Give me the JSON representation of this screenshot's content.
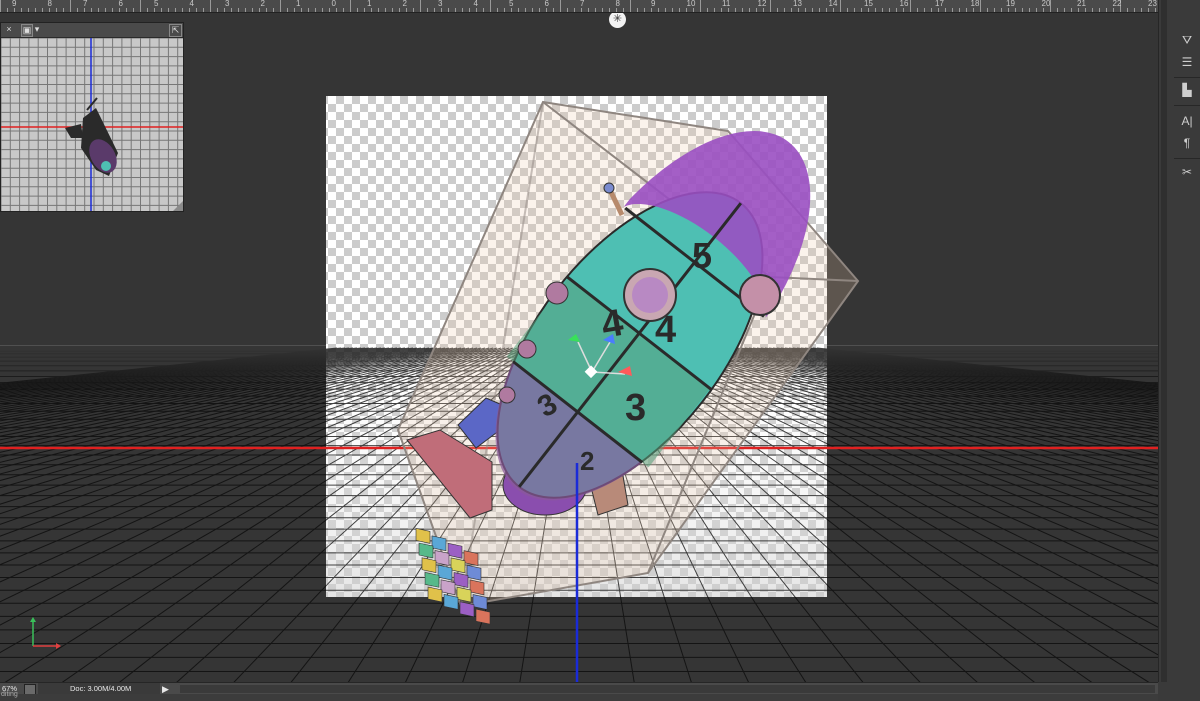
{
  "ruler": {
    "numbers": [
      "9",
      "8",
      "7",
      "6",
      "5",
      "4",
      "3",
      "2",
      "1",
      "0",
      "1",
      "2",
      "3",
      "4",
      "5",
      "6",
      "7",
      "8",
      "9",
      "10",
      "11",
      "12",
      "13",
      "14",
      "15",
      "16",
      "17",
      "18",
      "19",
      "20",
      "21",
      "22",
      "23"
    ]
  },
  "mini_view": {
    "close_label": "×",
    "menu_label": "▾"
  },
  "canvas": {
    "numbers": [
      "5",
      "4",
      "4",
      "3",
      "3",
      "2"
    ]
  },
  "status_bar": {
    "zoom": "67%",
    "doc_info": "Doc: 3.00M/4.00M",
    "bottom_text": "diting"
  },
  "colors": {
    "background": "#363636",
    "ruler": "#4a4a4a",
    "ground_line": "#e02020",
    "axis_line": "#1a2bd8",
    "panel": "#3a3a3a"
  },
  "icons": {
    "tools": [
      "brush-preset-icon",
      "adjustments-icon",
      "align-icon",
      "character-icon",
      "paragraph-icon",
      "tools-icon"
    ]
  }
}
